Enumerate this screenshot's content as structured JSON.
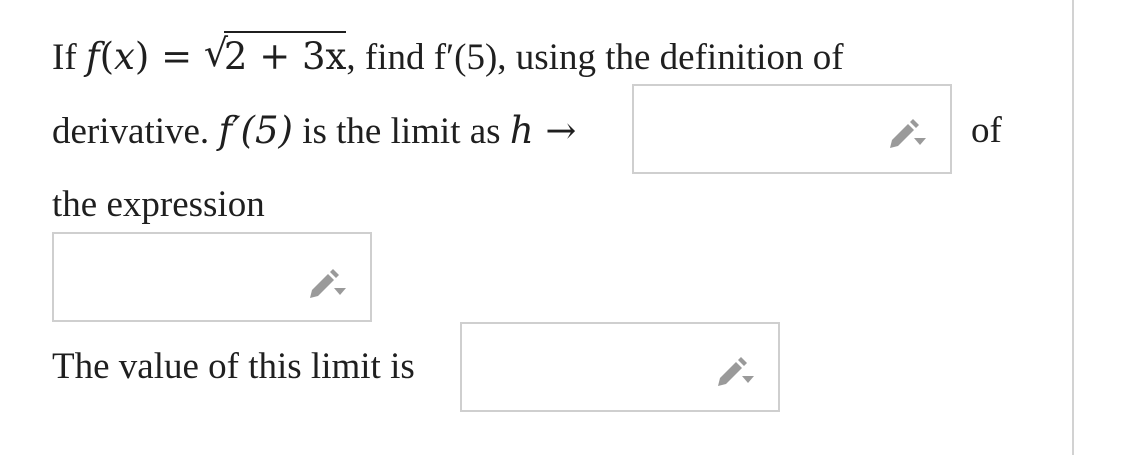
{
  "question": {
    "line1": {
      "prefix": "If ",
      "func": "f",
      "paren_open": "(",
      "var": "x",
      "paren_close_eq": ") = ",
      "radicand": "2 + 3x",
      "suffix": ", find f′(5), using the definition of"
    },
    "line2": {
      "text_a": "derivative. ",
      "fprime": "f′(5)",
      "text_b": " is the limit as ",
      "h": "h",
      "arrow": " →",
      "after_box": "of"
    },
    "line3": "the expression",
    "line4": "The value of this limit is"
  },
  "inputs": {
    "limit_target": {
      "value": ""
    },
    "expression": {
      "value": ""
    },
    "limit_value": {
      "value": ""
    }
  },
  "icons": {
    "edit": "pencil-dropdown-icon"
  },
  "colors": {
    "text": "#1f1f1f",
    "input_border": "#cfcfcf",
    "icon": "#9a9a9a"
  }
}
